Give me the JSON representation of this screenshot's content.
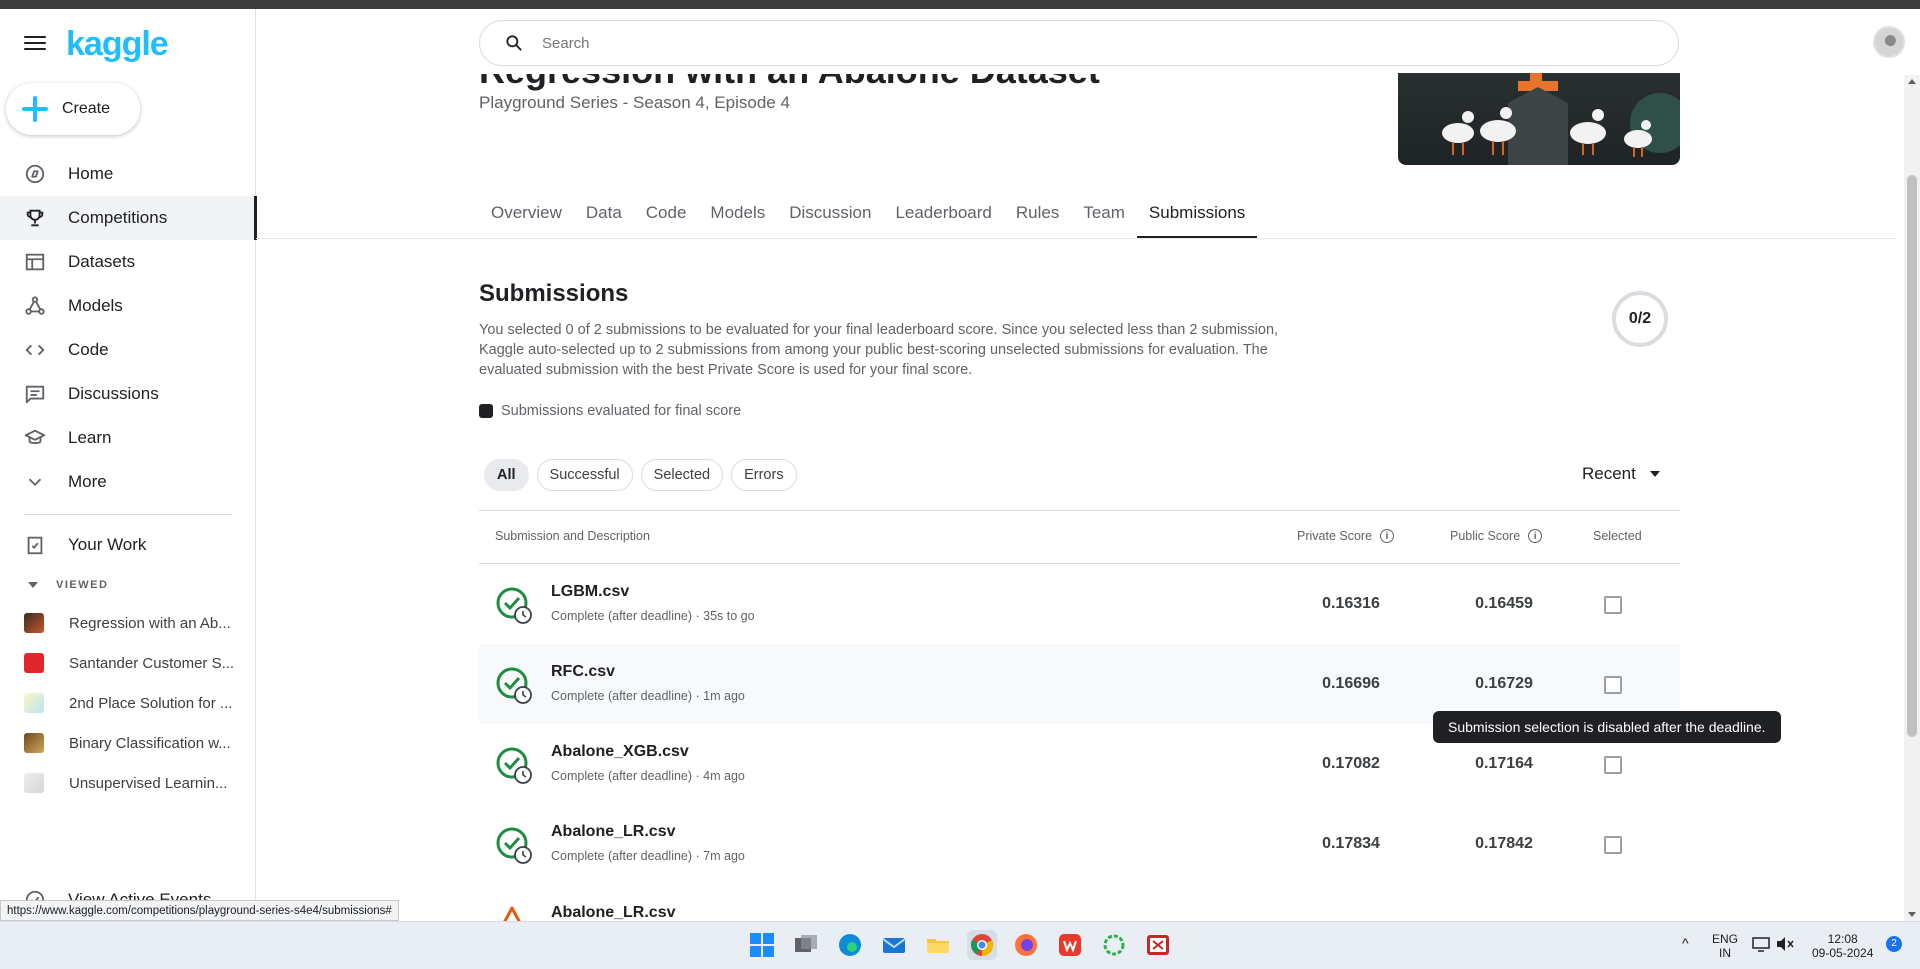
{
  "app": {
    "logo": "kaggle"
  },
  "sidebar": {
    "create_label": "Create",
    "nav": [
      {
        "label": "Home",
        "icon": "compass-icon"
      },
      {
        "label": "Competitions",
        "icon": "trophy-icon",
        "active": true
      },
      {
        "label": "Datasets",
        "icon": "table-icon"
      },
      {
        "label": "Models",
        "icon": "models-icon"
      },
      {
        "label": "Code",
        "icon": "code-icon"
      },
      {
        "label": "Discussions",
        "icon": "discussion-icon"
      },
      {
        "label": "Learn",
        "icon": "school-icon"
      },
      {
        "label": "More",
        "icon": "chevron-down-icon"
      }
    ],
    "your_work": "Your Work",
    "viewed_header": "VIEWED",
    "viewed": [
      "Regression with an Ab...",
      "Santander Customer S...",
      "2nd Place Solution for ...",
      "Binary Classification w...",
      "Unsupervised Learnin..."
    ],
    "active_events": "View Active Events"
  },
  "search": {
    "placeholder": "Search"
  },
  "competition": {
    "title": "Regression with an Abalone Dataset",
    "subtitle": "Playground Series - Season 4, Episode 4",
    "tabs": [
      "Overview",
      "Data",
      "Code",
      "Models",
      "Discussion",
      "Leaderboard",
      "Rules",
      "Team",
      "Submissions"
    ],
    "active_tab": "Submissions"
  },
  "submissions": {
    "title": "Submissions",
    "description": "You selected 0 of 2 submissions to be evaluated for your final leaderboard score. Since you selected less than 2 submission, Kaggle auto-selected up to 2 submissions from among your public best-scoring unselected submissions for evaluation. The evaluated submission with the best Private Score is used for your final score.",
    "counter": "0/2",
    "legend": "Submissions evaluated for final score",
    "filters": [
      "All",
      "Successful",
      "Selected",
      "Errors"
    ],
    "sort": "Recent",
    "headers": {
      "submission": "Submission and Description",
      "private": "Private Score",
      "public": "Public Score",
      "selected": "Selected"
    },
    "rows": [
      {
        "name": "LGBM.csv",
        "meta": "Complete (after deadline) · 35s to go",
        "private": "0.16316",
        "public": "0.16459"
      },
      {
        "name": "RFC.csv",
        "meta": "Complete (after deadline) · 1m ago",
        "private": "0.16696",
        "public": "0.16729"
      },
      {
        "name": "Abalone_XGB.csv",
        "meta": "Complete (after deadline) · 4m ago",
        "private": "0.17082",
        "public": "0.17164"
      },
      {
        "name": "Abalone_LR.csv",
        "meta": "Complete (after deadline) · 7m ago",
        "private": "0.17834",
        "public": "0.17842"
      },
      {
        "name": "Abalone_LR.csv",
        "meta": "",
        "private": "",
        "public": ""
      }
    ],
    "tooltip": "Submission selection is disabled after the deadline."
  },
  "browser_status": "https://www.kaggle.com/competitions/playground-series-s4e4/submissions#",
  "taskbar": {
    "lang_top": "ENG",
    "lang_bottom": "IN",
    "time": "12:08",
    "date": "09-05-2024",
    "notifications": "2"
  },
  "colors": {
    "accent": "#20beff",
    "success": "#1e8e3e",
    "text": "#202124"
  }
}
